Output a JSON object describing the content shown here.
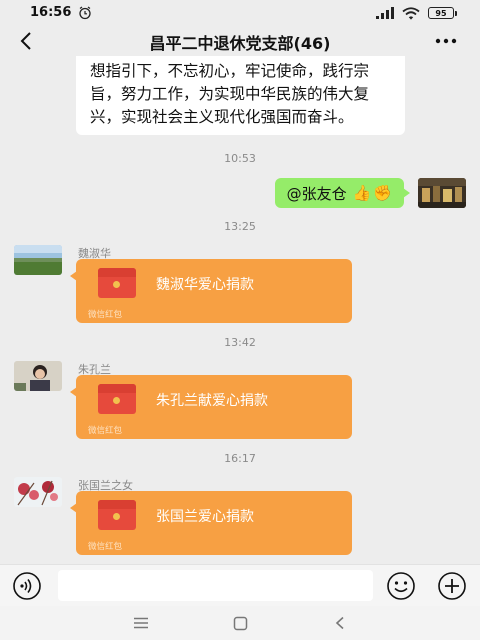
{
  "status_bar": {
    "time": "16:56",
    "battery": "95",
    "icons": [
      "alarm-icon",
      "signal-icon",
      "wifi-icon",
      "battery-icon"
    ]
  },
  "header": {
    "title": "昌平二中退休党支部(46)",
    "icons": [
      "back-arrow-icon",
      "more-dots-icon"
    ]
  },
  "messages": {
    "text_message": "想指引下，不忘初心，牢记使命，践行宗旨，努力工作，为实现中华民族的伟大复兴，实现社会主义现代化强国而奋斗。",
    "time_1": "10:53",
    "sent": {
      "text": "@张友仓",
      "emojis": [
        "👍",
        "✊"
      ]
    },
    "time_2": "13:25",
    "packet_1": {
      "sender": "魏淑华",
      "title": "魏淑华爱心捐款",
      "footer": "微信红包"
    },
    "time_3": "13:42",
    "packet_2": {
      "sender": "朱孔兰",
      "title": "朱孔兰献爱心捐款",
      "footer": "微信红包"
    },
    "time_4": "16:17",
    "packet_3": {
      "sender": "张国兰之女",
      "title": "张国兰爱心捐款",
      "footer": "微信红包"
    }
  },
  "input_bar": {
    "value": "",
    "icons": [
      "voice-icon",
      "emoji-face-icon",
      "plus-icon"
    ]
  },
  "nav_bar": {
    "icons": [
      "menu-lines-icon",
      "home-square-icon",
      "back-triangle-icon"
    ]
  },
  "colors": {
    "background": "#ededed",
    "sent_bubble": "#95ec69",
    "red_packet": "#f7a043"
  }
}
